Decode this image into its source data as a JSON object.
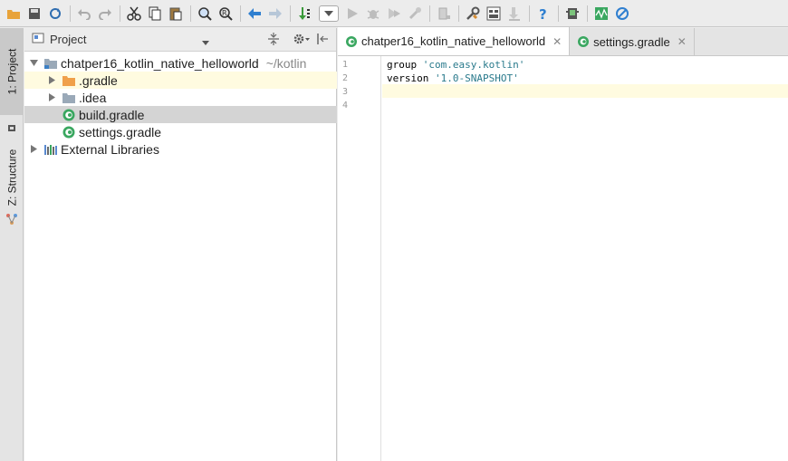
{
  "toolbar": {
    "icons": [
      "open-folder-icon",
      "save-icon",
      "sync-icon",
      "undo-icon",
      "redo-icon",
      "cut-icon",
      "copy-icon",
      "paste-icon",
      "find-icon",
      "replace-icon",
      "back-icon",
      "forward-icon",
      "make-project-icon",
      "run-config-dropdown",
      "run-icon",
      "debug-icon",
      "coverage-icon",
      "profile-icon",
      "stop-icon",
      "project-structure-icon",
      "settings-icon",
      "sdk-icon",
      "help-icon",
      "avd-manager-icon",
      "monitor-icon",
      "power-save-icon"
    ]
  },
  "tool_stripe": {
    "project_label": "1: Project",
    "structure_label": "Z: Structure"
  },
  "project_panel": {
    "title": "Project",
    "tree": [
      {
        "label": "chatper16_kotlin_native_helloworld",
        "hint": "~/kotlin",
        "icon": "module-folder-icon",
        "expanded": true
      },
      {
        "label": ".gradle",
        "icon": "orange-folder-icon",
        "expanded": false
      },
      {
        "label": ".idea",
        "icon": "folder-icon",
        "expanded": false
      },
      {
        "label": "build.gradle",
        "icon": "gradle-file-icon"
      },
      {
        "label": "settings.gradle",
        "icon": "gradle-file-icon"
      },
      {
        "label": "External Libraries",
        "icon": "libraries-icon",
        "expanded": false
      }
    ]
  },
  "editor": {
    "tabs": [
      {
        "label": "chatper16_kotlin_native_helloworld",
        "active": true
      },
      {
        "label": "settings.gradle",
        "active": false
      }
    ],
    "line_numbers": [
      "1",
      "2",
      "3",
      "4"
    ],
    "lines": [
      {
        "keyword": "group ",
        "string": "'com.easy.kotlin'"
      },
      {
        "keyword": "version ",
        "string": "'1.0-SNAPSHOT'"
      },
      {
        "keyword": "",
        "string": ""
      },
      {
        "keyword": "",
        "string": ""
      }
    ]
  },
  "colors": {
    "selection": "#d4d4d4",
    "highlight_row": "#fffbe0",
    "gradle_green": "#3aa760",
    "string_color": "#2a7a8c"
  }
}
